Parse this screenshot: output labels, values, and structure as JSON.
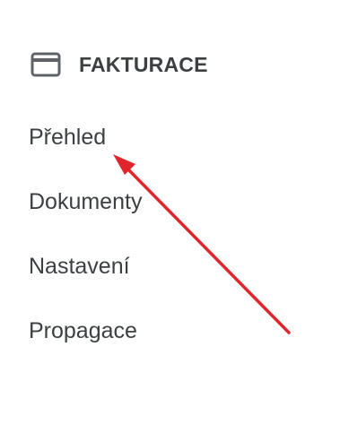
{
  "section": {
    "title": "FAKTURACE",
    "icon": "credit-card-icon"
  },
  "nav": {
    "items": [
      {
        "label": "Přehled"
      },
      {
        "label": "Dokumenty"
      },
      {
        "label": "Nastavení"
      },
      {
        "label": "Propagace"
      }
    ]
  },
  "annotation": {
    "arrow_color": "#e0262c"
  },
  "colors": {
    "text": "#3c4043",
    "icon": "#5f6368",
    "background": "#ffffff"
  }
}
